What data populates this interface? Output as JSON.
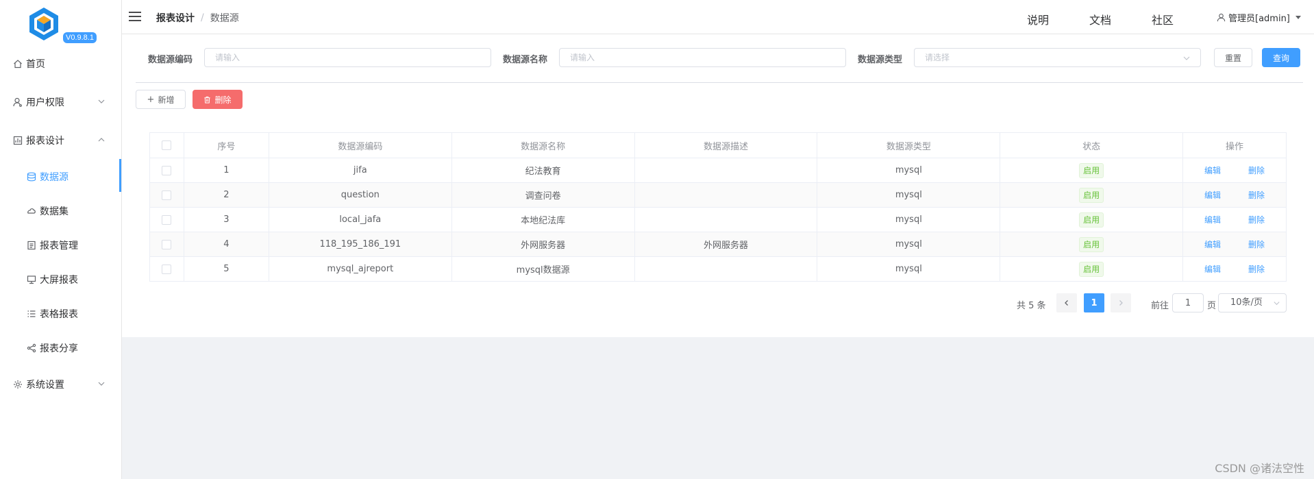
{
  "app": {
    "version": "V0.9.8.1"
  },
  "sidebar": {
    "items": [
      {
        "label": "首页",
        "icon": "home-icon"
      },
      {
        "label": "用户权限",
        "icon": "user-icon"
      },
      {
        "label": "报表设计",
        "icon": "report-icon"
      },
      {
        "label": "数据源",
        "icon": "database-icon",
        "active": true
      },
      {
        "label": "数据集",
        "icon": "dataset-icon"
      },
      {
        "label": "报表管理",
        "icon": "document-icon"
      },
      {
        "label": "大屏报表",
        "icon": "monitor-icon"
      },
      {
        "label": "表格报表",
        "icon": "list-icon"
      },
      {
        "label": "报表分享",
        "icon": "share-icon"
      },
      {
        "label": "系统设置",
        "icon": "gear-icon"
      }
    ]
  },
  "header": {
    "breadcrumb": [
      "报表设计",
      "数据源"
    ],
    "links": [
      "说明",
      "文档",
      "社区"
    ],
    "user": "管理员[admin]"
  },
  "filters": {
    "code_label": "数据源编码",
    "code_placeholder": "请输入",
    "name_label": "数据源名称",
    "name_placeholder": "请输入",
    "type_label": "数据源类型",
    "type_placeholder": "请选择",
    "reset": "重置",
    "search": "查询"
  },
  "toolbar": {
    "add": "新增",
    "delete": "删除"
  },
  "table": {
    "columns": [
      "序号",
      "数据源编码",
      "数据源名称",
      "数据源描述",
      "数据源类型",
      "状态",
      "操作"
    ],
    "rows": [
      {
        "no": "1",
        "code": "jifa",
        "name": "纪法教育",
        "desc": "",
        "type": "mysql",
        "status": "启用"
      },
      {
        "no": "2",
        "code": "question",
        "name": "调查问卷",
        "desc": "",
        "type": "mysql",
        "status": "启用"
      },
      {
        "no": "3",
        "code": "local_jafa",
        "name": "本地纪法库",
        "desc": "",
        "type": "mysql",
        "status": "启用"
      },
      {
        "no": "4",
        "code": "118_195_186_191",
        "name": "外网服务器",
        "desc": "外网服务器",
        "type": "mysql",
        "status": "启用"
      },
      {
        "no": "5",
        "code": "mysql_ajreport",
        "name": "mysql数据源",
        "desc": "",
        "type": "mysql",
        "status": "启用"
      }
    ],
    "edit": "编辑",
    "delete": "删除"
  },
  "pagination": {
    "total": "共 5 条",
    "current": "1",
    "goto": "前往",
    "goto_value": "1",
    "page_unit": "页",
    "page_size": "10条/页"
  },
  "watermark": "CSDN @诸法空性",
  "colors": {
    "primary": "#409eff",
    "danger": "#f56c6c",
    "success": "#67c23a"
  }
}
